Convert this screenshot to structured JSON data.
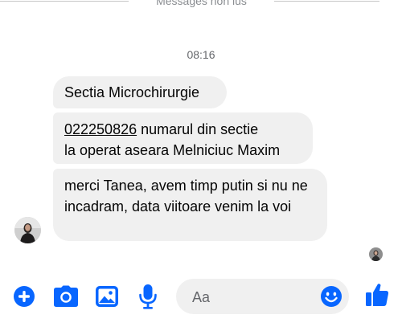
{
  "unread_divider": {
    "label": "Messages non lus"
  },
  "timestamp": "08:16",
  "messages": [
    {
      "text": "Sectia Microchirurgie"
    },
    {
      "phone": "022250826",
      "line1_rest": " numarul din sectie",
      "line2": "la operat aseara Melniciuc Maxim"
    },
    {
      "text": "merci Tanea, avem timp putin si nu ne incadram, data viitoare venim la voi"
    }
  ],
  "composer": {
    "placeholder": "Aa",
    "value": ""
  },
  "colors": {
    "accent": "#0866ff",
    "bubble": "#f0f0f0",
    "muted_text": "#65676b"
  },
  "icons": {
    "add": "plus-circle-icon",
    "camera": "camera-icon",
    "gallery": "image-icon",
    "mic": "microphone-icon",
    "emoji": "smiley-icon",
    "like": "thumbs-up-icon"
  }
}
